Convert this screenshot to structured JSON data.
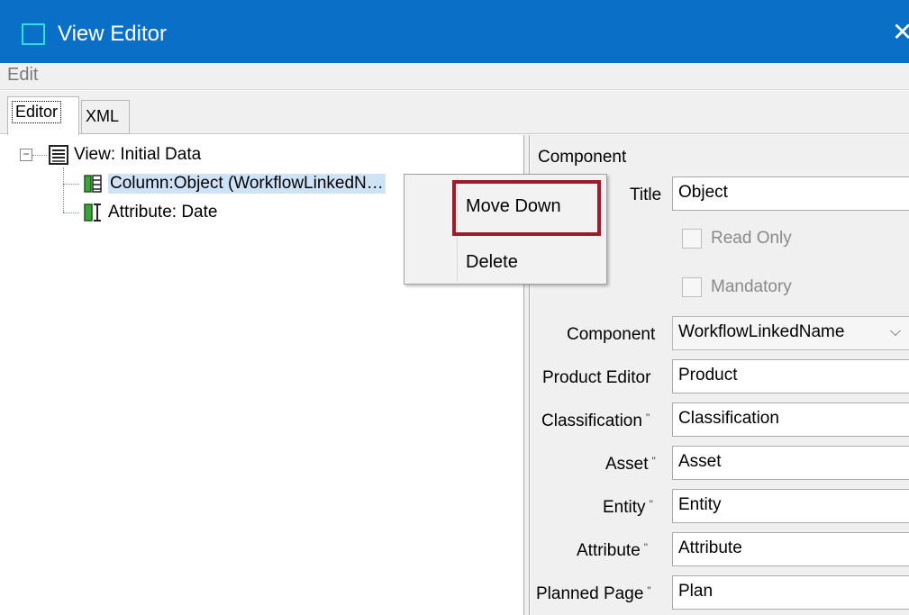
{
  "window": {
    "title": "View Editor",
    "close_glyph": "✕"
  },
  "menu": {
    "items": [
      "Edit"
    ]
  },
  "tabs": [
    {
      "label": "Editor",
      "active": true
    },
    {
      "label": "XML",
      "active": false
    }
  ],
  "tree": {
    "root": {
      "label": "View: Initial Data",
      "icon": "view-list-icon",
      "expanded": true
    },
    "children": [
      {
        "label": "Column:Object (WorkflowLinkedN…",
        "icon": "column-icon",
        "selected": true
      },
      {
        "label": "Attribute: Date",
        "icon": "attribute-icon",
        "selected": false
      }
    ]
  },
  "context_menu": {
    "items": [
      {
        "label": "Move Down",
        "highlighted": true
      },
      {
        "label": "Delete",
        "highlighted": false
      }
    ],
    "highlight_color": "#9b1c2a"
  },
  "properties": {
    "section_title": "Component",
    "title_label": "Title",
    "title_value": "Object",
    "read_only_label": "Read Only",
    "mandatory_label": "Mandatory",
    "component_label": "Component",
    "component_value": "WorkflowLinkedName",
    "product_editor_label": "Product Editor",
    "product_editor_value": "Product",
    "classification_label": "Classification",
    "classification_value": "Classification",
    "asset_label": "Asset",
    "asset_value": "Asset",
    "entity_label": "Entity",
    "entity_value": "Entity",
    "attribute_label": "Attribute",
    "attribute_value": "Attribute",
    "planned_page_label": "Planned Page",
    "planned_page_value": "Plan",
    "required_marker": "\""
  },
  "colors": {
    "titlebar": "#0a6fc6",
    "selection": "#cfe3f7",
    "panel_bg": "#f0f0f0"
  }
}
